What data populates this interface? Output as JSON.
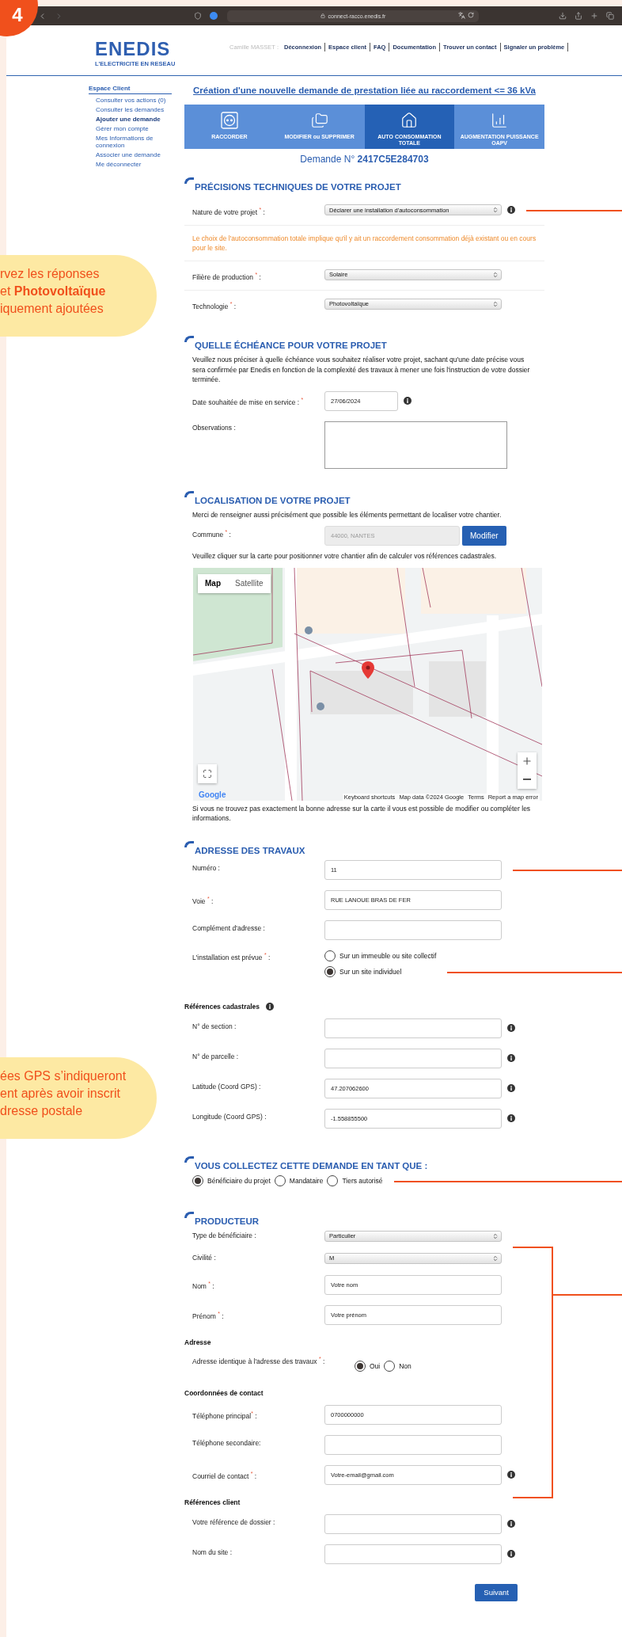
{
  "step_badge": "4",
  "callouts": [
    {
      "lines": [
        "rvez les réponses",
        "et **Photovoltaïque**",
        "iquement ajoutées"
      ]
    },
    {
      "lines": [
        "ées GPS s’indiqueront",
        "ent après avoir inscrit",
        "dresse postale"
      ]
    }
  ],
  "browser": {
    "url": "connect-racco.enedis.fr"
  },
  "header": {
    "logo": "ENEDIS",
    "tagline": "L'ELECTRICITE EN RESEAU",
    "user": "Camille MASSET :",
    "nav": [
      "Déconnexion",
      "Espace client",
      "FAQ",
      "Documentation",
      "Trouver un contact",
      "Signaler un problème"
    ]
  },
  "sidebar": {
    "title": "Espace Client",
    "items": [
      {
        "label": "Consulter vos actions (0)",
        "selected": false
      },
      {
        "label": "Consulter les demandes",
        "selected": false
      },
      {
        "label": "Ajouter une demande",
        "selected": true
      },
      {
        "label": "Gérer mon compte",
        "selected": false
      },
      {
        "label": "Mes Informations de connexion",
        "selected": false
      },
      {
        "label": "Associer une demande",
        "selected": false
      },
      {
        "label": "Me déconnecter",
        "selected": false
      }
    ]
  },
  "page_title": "Création d'une nouvelle demande de prestation liée au raccordement <= 36 kVa",
  "tabs": [
    {
      "label": "RACCORDER",
      "selected": false
    },
    {
      "label": "MODIFIER ou SUPPRIMER",
      "selected": false
    },
    {
      "label": "AUTO CONSOMMATION TOTALE",
      "selected": true
    },
    {
      "label": "AUGMENTATION PUISSANCE OAPV",
      "selected": false
    }
  ],
  "demande": {
    "label": "Demande N°",
    "number": "2417C5E284703"
  },
  "sections": [
    {
      "heading": "PRÉCISIONS TECHNIQUES DE VOTRE PROJET",
      "ruled": true,
      "rows": [
        {
          "kind": "select",
          "label": "Nature de votre projet $^{*}$ :",
          "value": "Déclarer une installation d'autoconsommation",
          "info": true,
          "annotated": true
        },
        {
          "kind": "note",
          "text": "Le choix de l'autoconsommation totale implique qu'il y ait un raccordement consommation déjà existant ou en cours pour le site."
        },
        {
          "kind": "select",
          "label": "Filière de production $^{*}$ :",
          "value": "Solaire"
        },
        {
          "kind": "select",
          "label": "Technologie $^{*}$ :",
          "value": "Photovoltaïque"
        }
      ]
    },
    {
      "heading": "QUELLE ÉCHÉANCE POUR VOTRE PROJET",
      "rows": [
        {
          "kind": "paragraph",
          "text": "Veuillez nous préciser à quelle échéance vous souhaitez réaliser votre projet, sachant qu'une date précise vous sera confirmée par Enedis en fonction de la complexité des travaux à mener une fois l'instruction de votre dossier terminée."
        },
        {
          "kind": "date",
          "label": "Date souhaitée de mise en service : $^{*}$",
          "value": "27/06/2024",
          "info": true
        },
        {
          "kind": "textarea",
          "label": "Observations :"
        }
      ]
    },
    {
      "heading": "LOCALISATION DE VOTRE PROJET",
      "rows": [
        {
          "kind": "paragraph",
          "text": "Merci de renseigner aussi précisément que possible les éléments permettant de localiser votre chantier."
        },
        {
          "kind": "commune",
          "label": "Commune $^{*}$ :",
          "value": "44000, NANTES",
          "button": "Modifier"
        },
        {
          "kind": "paragraph",
          "text": "Veuillez cliquer sur la carte pour positionner votre chantier afin de calculer vos références cadastrales."
        },
        {
          "kind": "map",
          "map_types": [
            {
              "label": "Map",
              "selected": true
            },
            {
              "label": "Satellite",
              "selected": false
            }
          ],
          "logo": "Google",
          "attribution": [
            "Keyboard shortcuts",
            "Map data ©2024 Google",
            "Terms",
            "Report a map error"
          ]
        },
        {
          "kind": "paragraph",
          "text": "Si vous ne trouvez pas exactement la bonne adresse sur la carte il vous est possible de modifier ou compléter les informations."
        }
      ]
    },
    {
      "heading": "ADRESSE DES TRAVAUX",
      "rows": [
        {
          "kind": "input",
          "label": "Numéro :",
          "value": "11",
          "annotated": true
        },
        {
          "kind": "input",
          "label": "Voie $^{*}$ :",
          "value": "RUE LANOUE BRAS DE FER"
        },
        {
          "kind": "input",
          "label": "Complément d'adresse :"
        },
        {
          "kind": "radios",
          "label": "L'installation est prévue $^{*}$ :",
          "options": [
            {
              "label": "Sur un immeuble ou site collectif",
              "selected": false
            },
            {
              "label": "Sur un site individuel",
              "selected": true,
              "annotated": true
            }
          ]
        },
        {
          "kind": "subheading",
          "text": "Références cadastrales",
          "info": true
        },
        {
          "kind": "input",
          "label": "N° de section :",
          "info": true
        },
        {
          "kind": "input",
          "label": "N° de parcelle :",
          "info": true
        },
        {
          "kind": "input",
          "label": "Latitude (Coord GPS)  :",
          "value": "47.207062600",
          "info": true
        },
        {
          "kind": "input",
          "label": "Longitude (Coord GPS)  :",
          "value": "-1.558855500",
          "info": true
        }
      ]
    },
    {
      "heading": "VOUS COLLECTEZ CETTE DEMANDE EN TANT QUE :",
      "rows": [
        {
          "kind": "radio_line",
          "options": [
            {
              "label": "Bénéficiaire du projet",
              "selected": true
            },
            {
              "label": "Mandataire",
              "selected": false
            },
            {
              "label": "Tiers autorisé",
              "selected": false,
              "annotated": true
            }
          ]
        }
      ]
    },
    {
      "heading": "PRODUCTEUR",
      "bracket": true,
      "rows": [
        {
          "kind": "select",
          "label": "Type de bénéficiaire :",
          "value": "Particulier"
        },
        {
          "kind": "select",
          "label": "Civilité :",
          "value": "M"
        },
        {
          "kind": "input",
          "label": "Nom $^{*}$ :",
          "value": "Votre nom"
        },
        {
          "kind": "input",
          "label": "Prénom $^{*}$ :",
          "value": "Votre prénom"
        },
        {
          "kind": "subheading",
          "text": "Adresse"
        },
        {
          "kind": "radios_inline",
          "label": "Adresse identique à l'adresse des travaux $^{*}$ :",
          "options": [
            {
              "label": "Oui",
              "selected": true
            },
            {
              "label": "Non",
              "selected": false
            }
          ]
        },
        {
          "kind": "subheading",
          "text": "Coordonnées de contact"
        },
        {
          "kind": "input",
          "label": "Téléphone principal$^{*}$ :",
          "value": "0700000000"
        },
        {
          "kind": "input",
          "label": "Téléphone secondaire:"
        },
        {
          "kind": "input",
          "label": "Courriel de contact $^{*}$ :",
          "value": "Votre-email@gmail.com",
          "info": true
        },
        {
          "kind": "subheading",
          "text": "Références client"
        },
        {
          "kind": "input",
          "label": "Votre référence de dossier :",
          "info": true
        },
        {
          "kind": "input",
          "label": "Nom du site :",
          "info": true
        }
      ]
    }
  ],
  "submit": "Suivant"
}
